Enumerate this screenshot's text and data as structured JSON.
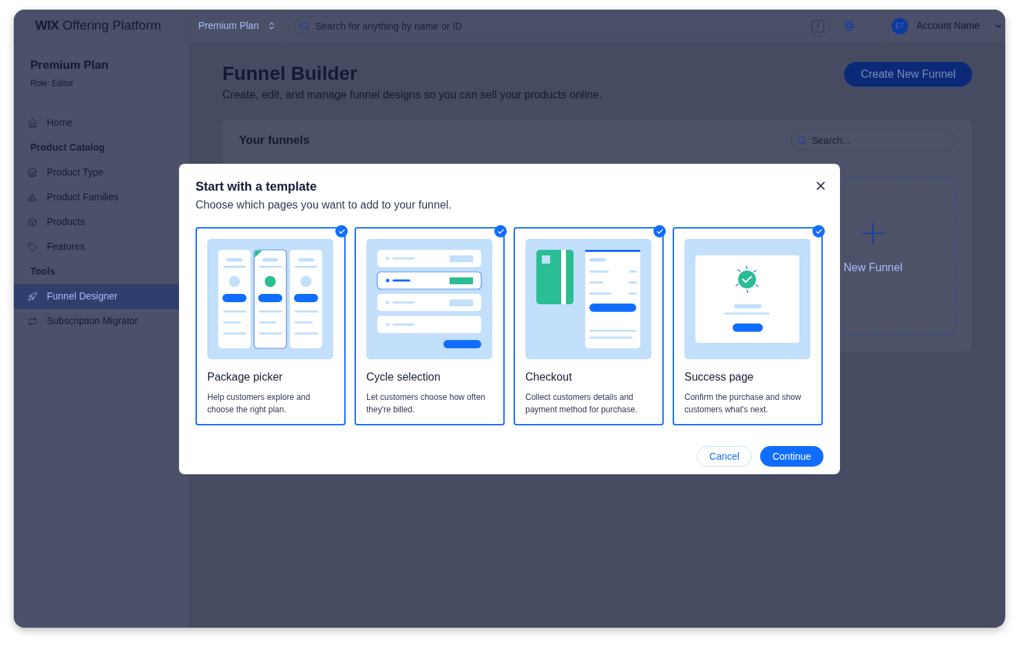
{
  "app": {
    "logo_brand": "WIX",
    "logo_text": "Offering Platform"
  },
  "header": {
    "plan_selector": "Premium Plan",
    "search_placeholder": "Search for anything by name or ID",
    "shortcut_key": "/",
    "account": {
      "initials": "ET",
      "name": "Account Name"
    }
  },
  "sidebar": {
    "title": "Premium Plan",
    "role": "Role: Editor",
    "items": [
      {
        "kind": "link",
        "label": "Home",
        "selected": false
      },
      {
        "kind": "section",
        "label": "Product Catalog"
      },
      {
        "kind": "link",
        "label": "Product Type",
        "selected": false
      },
      {
        "kind": "link",
        "label": "Product Families",
        "selected": false
      },
      {
        "kind": "link",
        "label": "Products",
        "selected": false
      },
      {
        "kind": "link",
        "label": "Features",
        "selected": false
      },
      {
        "kind": "section",
        "label": "Tools"
      },
      {
        "kind": "link",
        "label": "Funnel Designer",
        "selected": true
      },
      {
        "kind": "link",
        "label": "Subscription Migrator",
        "selected": false
      }
    ]
  },
  "page": {
    "title": "Funnel Builder",
    "subtitle": "Create, edit, and manage funnel designs so you can sell your products online.",
    "create_button": "Create New Funnel",
    "panel": {
      "title": "Your funnels",
      "search_placeholder": "Search...",
      "new_tile_label": "New Funnel"
    }
  },
  "dialog": {
    "title": "Start with a template",
    "subtitle": "Choose which pages you want to add to your funnel.",
    "templates": [
      {
        "kind": "package",
        "title": "Package picker",
        "description": "Help customers explore and choose the right plan.",
        "checked": true
      },
      {
        "kind": "cycle",
        "title": "Cycle selection",
        "description": "Let customers choose how often they're billed.",
        "checked": true
      },
      {
        "kind": "checkout",
        "title": "Checkout",
        "description": "Collect customers details and payment method for purchase.",
        "checked": true
      },
      {
        "kind": "success",
        "title": "Success page",
        "description": "Confirm the purchase and show customers what's next.",
        "checked": true
      }
    ],
    "cancel_button": "Cancel",
    "continue_button": "Continue"
  }
}
